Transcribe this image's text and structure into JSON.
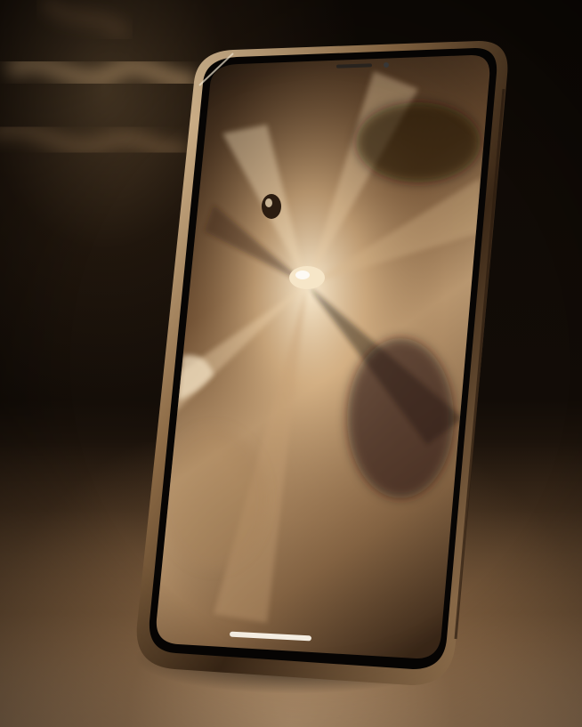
{
  "scene": {
    "subject": "smartphone-standing-on-surface",
    "tone": "sepia",
    "palette": {
      "background": "#0b0704",
      "highlight": "#e8c9a0",
      "midtone": "#9c7650",
      "frame": "#c9a67c"
    }
  },
  "phone": {
    "screen": "abstract-liquid-splash-wallpaper"
  }
}
